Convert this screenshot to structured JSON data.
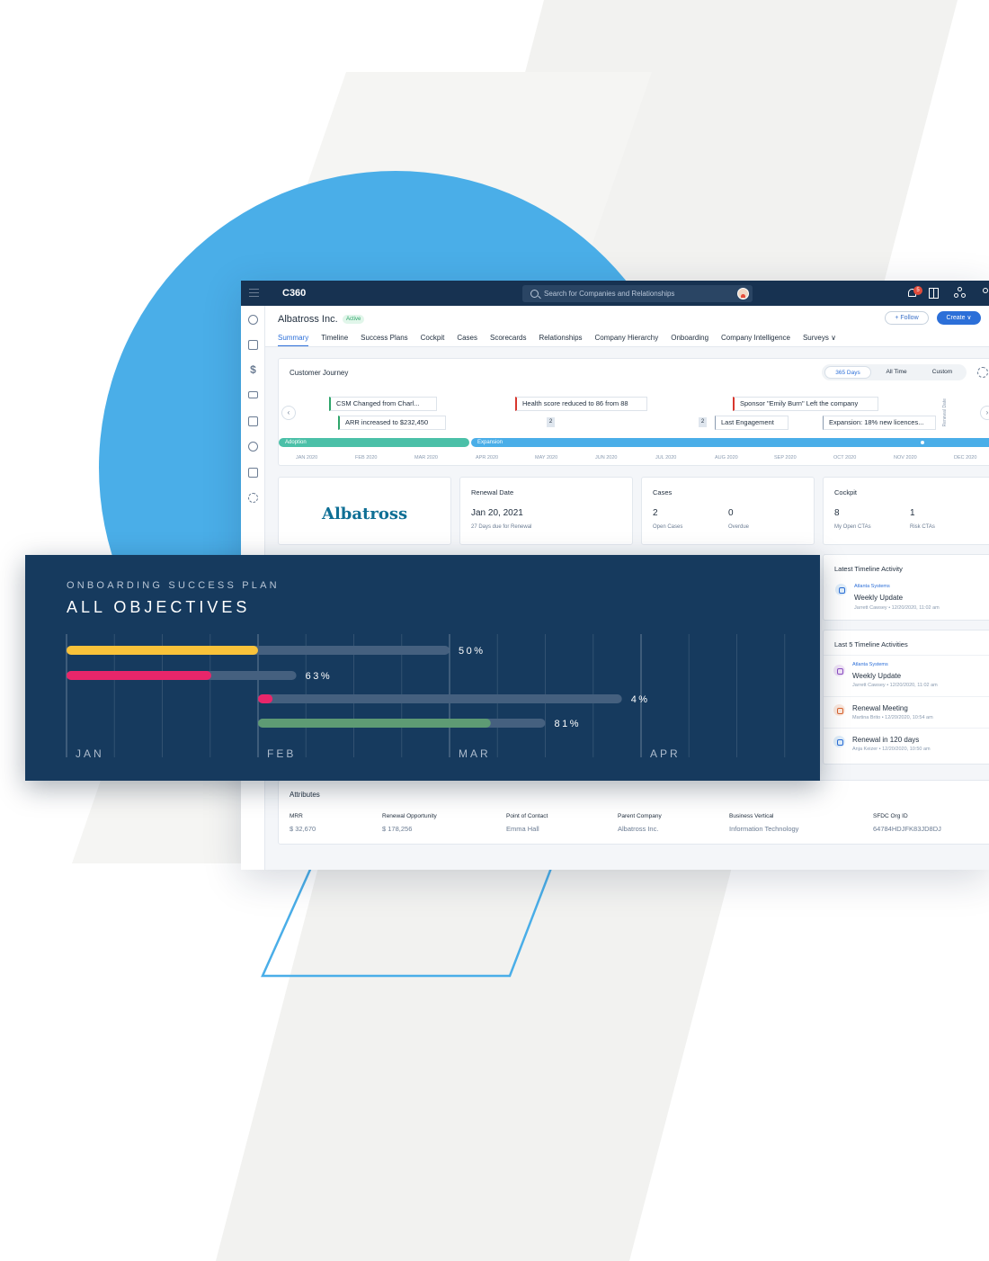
{
  "topbar": {
    "brand": "C360",
    "search_placeholder": "Search for Companies and Relationships",
    "notification_count": "5"
  },
  "header": {
    "company": "Albatross Inc.",
    "status": "Active",
    "follow_label": "+ Follow",
    "create_label": "Create ∨"
  },
  "tabs": [
    {
      "label": "Summary",
      "selected": true
    },
    {
      "label": "Timeline"
    },
    {
      "label": "Success Plans"
    },
    {
      "label": "Cockpit"
    },
    {
      "label": "Cases"
    },
    {
      "label": "Scorecards"
    },
    {
      "label": "Relationships"
    },
    {
      "label": "Company Hierarchy"
    },
    {
      "label": "Onboarding"
    },
    {
      "label": "Company Intelligence"
    },
    {
      "label": "Surveys ∨"
    }
  ],
  "journey": {
    "title": "Customer Journey",
    "ranges": [
      "365 Days",
      "All Time",
      "Custom"
    ],
    "selected_range": "365 Days",
    "events": [
      "CSM Changed from Charl...",
      "ARR increased to $232,450",
      "Health score reduced to 86 from 88",
      "Sponsor \"Emily Burn\" Left the company",
      "Last Engagement",
      "Expansion: 18% new licences..."
    ],
    "counts": [
      "2",
      "2"
    ],
    "phases": [
      "Adoption",
      "Expansion"
    ],
    "months": [
      "JAN 2020",
      "FEB 2020",
      "MAR 2020",
      "APR 2020",
      "MAY 2020",
      "JUN 2020",
      "JUL 2020",
      "AUG 2020",
      "SEP 2020",
      "OCT 2020",
      "NOV 2020",
      "DEC 2020"
    ],
    "renewal_label": "Renewal Date"
  },
  "logo": {
    "text": "Albatross"
  },
  "renewal": {
    "title": "Renewal Date",
    "value": "Jan 20, 2021",
    "sub": "27 Days due for Renewal"
  },
  "cases": {
    "title": "Cases",
    "open": "2",
    "open_label": "Open Cases",
    "overdue": "0",
    "overdue_label": "Overdue"
  },
  "cockpit": {
    "title": "Cockpit",
    "open": "8",
    "open_label": "My Open CTAs",
    "risk": "1",
    "risk_label": "Risk CTAs"
  },
  "latest_activity": {
    "title": "Latest Timeline Activity",
    "company": "Atlanta Systems",
    "name": "Weekly Update",
    "meta": "Jarrett Cawsey  •  12/20/2020, 11:02 am"
  },
  "last5": {
    "title": "Last 5 Timeline Activities",
    "items": [
      {
        "company": "Atlanta Systems",
        "name": "Weekly Update",
        "meta": "Jarrett Cawsey  •  12/20/2020, 11:02 am"
      },
      {
        "company": "",
        "name": "Renewal Meeting",
        "meta": "Martina Brito  •  12/20/2020, 10:54 am"
      },
      {
        "company": "",
        "name": "Renewal in 120 days",
        "meta": "Anja Keizer  •  12/20/2020, 10:50 am"
      }
    ]
  },
  "attributes": {
    "title": "Attributes",
    "items": [
      {
        "label": "MRR",
        "value": "$ 32,670"
      },
      {
        "label": "Renewal Opportunity",
        "value": "$ 178,256"
      },
      {
        "label": "Point of Contact",
        "value": "Emma Hall"
      },
      {
        "label": "Parent Company",
        "value": "Albatross Inc."
      },
      {
        "label": "Business Vertical",
        "value": "Information Technology"
      },
      {
        "label": "SFDC Org ID",
        "value": "64784HDJFK83JD8DJ"
      }
    ]
  },
  "overlay": {
    "subtitle": "ONBOARDING SUCCESS PLAN",
    "title": "ALL OBJECTIVES"
  },
  "colors": {
    "navy": "#173251",
    "panel": "#163a5e",
    "accent_blue": "#2c6fd8",
    "circle_blue": "#4aaee8",
    "yellow": "#f8c23a",
    "pink": "#e8266a",
    "green": "#5e9b74",
    "track": "#45607f"
  },
  "chart_data": {
    "type": "bar",
    "title": "ALL OBJECTIVES",
    "categories": [
      "JAN",
      "FEB",
      "MAR",
      "APR"
    ],
    "series": [
      {
        "start": 0.0,
        "end": 2.0,
        "progress": 50,
        "label": "50%",
        "color": "#f8c23a"
      },
      {
        "start": 0.0,
        "end": 1.2,
        "progress": 63,
        "label": "63%",
        "color": "#e8266a"
      },
      {
        "start": 1.0,
        "end": 2.9,
        "progress": 4,
        "label": "4%",
        "color": "#e8266a"
      },
      {
        "start": 1.0,
        "end": 2.5,
        "progress": 81,
        "label": "81%",
        "color": "#5e9b74"
      }
    ],
    "xlim": [
      0,
      3.7
    ],
    "grid": true
  }
}
